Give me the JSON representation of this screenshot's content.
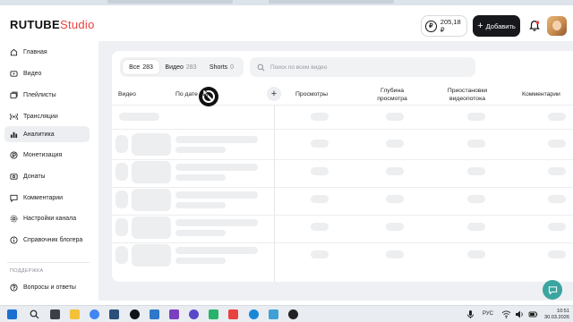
{
  "header": {
    "logo_brand": "RUTUBE",
    "logo_studio": "Studio",
    "balance": "205,18 ₽",
    "currency_symbol": "₽",
    "add_button_label": "Добавить"
  },
  "sidebar": {
    "items": [
      {
        "label": "Главная",
        "icon": "home-icon"
      },
      {
        "label": "Видео",
        "icon": "video-icon"
      },
      {
        "label": "Плейлисты",
        "icon": "playlist-icon"
      },
      {
        "label": "Трансляции",
        "icon": "broadcast-icon"
      },
      {
        "label": "Аналитика",
        "icon": "analytics-icon",
        "active": true
      },
      {
        "label": "Монетизация",
        "icon": "monetization-icon"
      },
      {
        "label": "Донаты",
        "icon": "donate-icon"
      },
      {
        "label": "Комментарии",
        "icon": "comments-icon"
      },
      {
        "label": "Настройки канала",
        "icon": "settings-icon"
      },
      {
        "label": "Справочник блогера",
        "icon": "info-icon"
      }
    ],
    "support_title": "ПОДДЕРЖКА",
    "support_items": [
      {
        "label": "Вопросы и ответы",
        "icon": "help-icon"
      }
    ]
  },
  "main": {
    "tabs": [
      {
        "label": "Все",
        "count": "283",
        "active": true
      },
      {
        "label": "Видео",
        "count": "283"
      },
      {
        "label": "Shorts",
        "count": "0"
      }
    ],
    "search_placeholder": "Поиск по всем видео",
    "columns": {
      "video": "Видео",
      "date": "По дате",
      "views": "Просмотры",
      "depth_1": "Глубина",
      "depth_2": "просмотра",
      "stops_1": "Приостановки",
      "stops_2": "видеопотока",
      "comments": "Комментарии"
    }
  },
  "taskbar": {
    "lang": "РУС",
    "time": "10:51",
    "date": "30.03.2026"
  },
  "colors": {
    "accent": "#e8413f",
    "dark_button": "#17181c",
    "main_bg": "#eef0f3",
    "skeleton": "#eceef0",
    "help_fab": "#3ba5a0"
  }
}
